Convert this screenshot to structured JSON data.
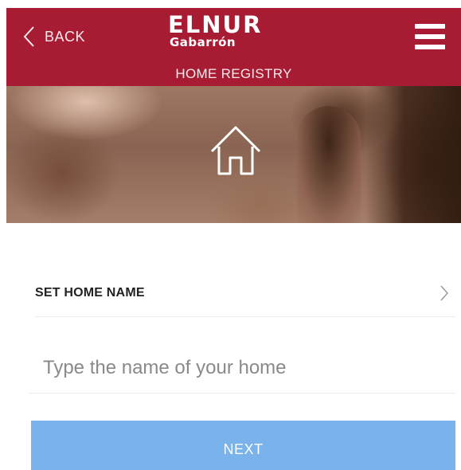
{
  "header": {
    "back_label": "BACK",
    "logo": {
      "line1": "ELNUR",
      "line2": "Gabarrón"
    },
    "title": "HOME REGISTRY",
    "background_color": "#a81c33"
  },
  "hero": {
    "icon": "home-outline-icon"
  },
  "form": {
    "set_home_name_label": "SET HOME NAME",
    "name_input": {
      "value": "",
      "placeholder": "Type the name of your home"
    },
    "next_label": "NEXT",
    "next_button_color": "#7ab2ec"
  },
  "icons": {
    "back": "chevron-left-icon",
    "menu": "hamburger-menu-icon",
    "row": "chevron-right-icon"
  }
}
